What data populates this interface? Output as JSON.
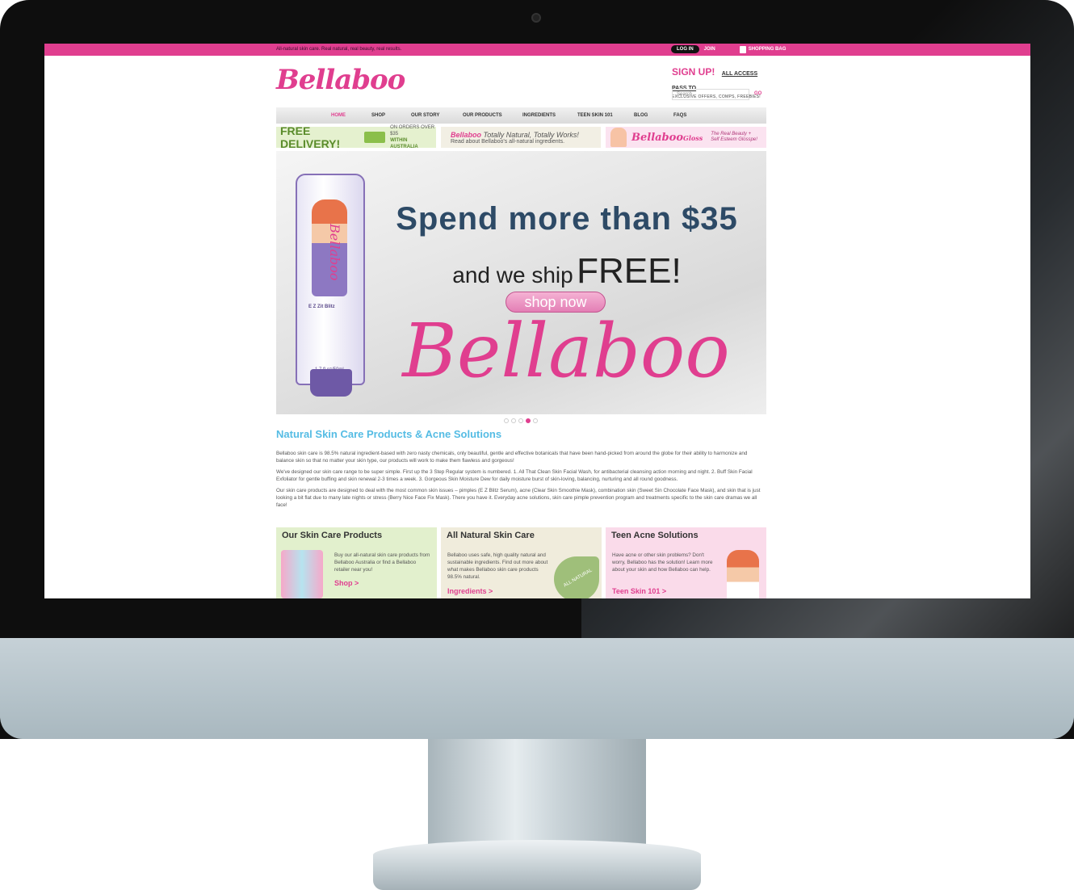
{
  "topbar": {
    "tagline": "All-natural skin care. Real natural, real beauty, real results.",
    "login": "LOG IN",
    "join": "JOIN",
    "bag": "SHOPPING BAG"
  },
  "header": {
    "logo": "Bellaboo",
    "signup": "SIGN UP!",
    "pass": "ALL ACCESS PASS TO",
    "offers": "EXCLUSIVE OFFERS, COMPS, FREEBIES!",
    "search_placeholder": "Search",
    "go": "GO"
  },
  "nav": [
    {
      "label": "HOME",
      "active": true
    },
    {
      "label": "SHOP"
    },
    {
      "label": "OUR STORY"
    },
    {
      "label": "OUR PRODUCTS"
    },
    {
      "label": "INGREDIENTS"
    },
    {
      "label": "TEEN SKIN 101"
    },
    {
      "label": "BLOG"
    },
    {
      "label": "FAQS"
    }
  ],
  "promos": {
    "delivery": {
      "free": "FREE DELIVERY!",
      "orders": "ON ORDERS OVER $35",
      "within": "WITHIN AUSTRALIA"
    },
    "natural": {
      "brand": "Bellaboo",
      "title": "Totally Natural, Totally Works!",
      "sub": "Read about Bellaboo's all-natural ingredients."
    },
    "gloss": {
      "brand": "Bellaboo",
      "gloss": "Gloss",
      "sub1": "The Real Beauty +",
      "sub2": "Self Esteem Glosspe!"
    }
  },
  "hero": {
    "spend": "Spend more than $35",
    "ship_small": "and we ship",
    "ship_big": "FREE!",
    "shop_now": "shop now",
    "logo": "Bellaboo",
    "tube_label": "E Z Zit Blitz",
    "tube_size": "1.7 fl oz/50ml",
    "tube_brand": "Bellaboo",
    "active_slide": 4,
    "slide_count": 5
  },
  "intro": {
    "heading": "Natural Skin Care Products & Acne Solutions",
    "p1": "Bellaboo skin care is 98.5% natural ingredient-based with zero nasty chemicals, only beautiful, gentle and effective botanicals that have been hand-picked from around the globe for their ability to harmonize and balance skin so that no matter your skin type, our products will work to make them flawless and gorgeous!",
    "p2": "We've designed our skin care range to be super simple. First up the 3 Step Regular system is numbered. 1. All That Clean Skin Facial Wash, for antibacterial cleansing action morning and night. 2. Buff Skin Facial Exfoliator for gentle buffing and skin renewal 2-3 times a week. 3. Gorgeous Skin Moisture Dew for daily moisture burst of skin-loving, balancing, nurturing and all round goodness.",
    "p3": "Our skin care products are designed to deal with the most common skin issues – pimples (E Z Blitz Serum), acne (Clear Skin Smoothie Mask), combination skin (Sweet Sin Chocolate Face Mask), and skin that is just looking a bit flat due to many late nights or stress (Berry Nice Face Fix Mask). There you have it. Everyday acne solutions, skin care pimple prevention program and treatments specific to the skin care dramas we all face!"
  },
  "boxes": {
    "products": {
      "title": "Our Skin Care Products",
      "text": "Buy our all-natural skin care products from Bellaboo Australia or find a Bellaboo retailer near you!",
      "link": "Shop >"
    },
    "natural": {
      "title": "All Natural Skin Care",
      "text": "Bellaboo uses safe, high quality natural and sustainable ingredients. Find out more about what makes Bellaboo skin care products 98.5% natural.",
      "badge": "ALL NATURAL",
      "link": "Ingredients >"
    },
    "teen": {
      "title": "Teen Acne Solutions",
      "text": "Have acne or other skin problems? Don't worry, Bellaboo has the solution! Learn more about your skin and how Bellaboo can help.",
      "link": "Teen Skin 101 >"
    }
  },
  "colors": {
    "brand_pink": "#e03e8f",
    "heading_blue": "#55bce4",
    "green": "#5a8c2b"
  }
}
